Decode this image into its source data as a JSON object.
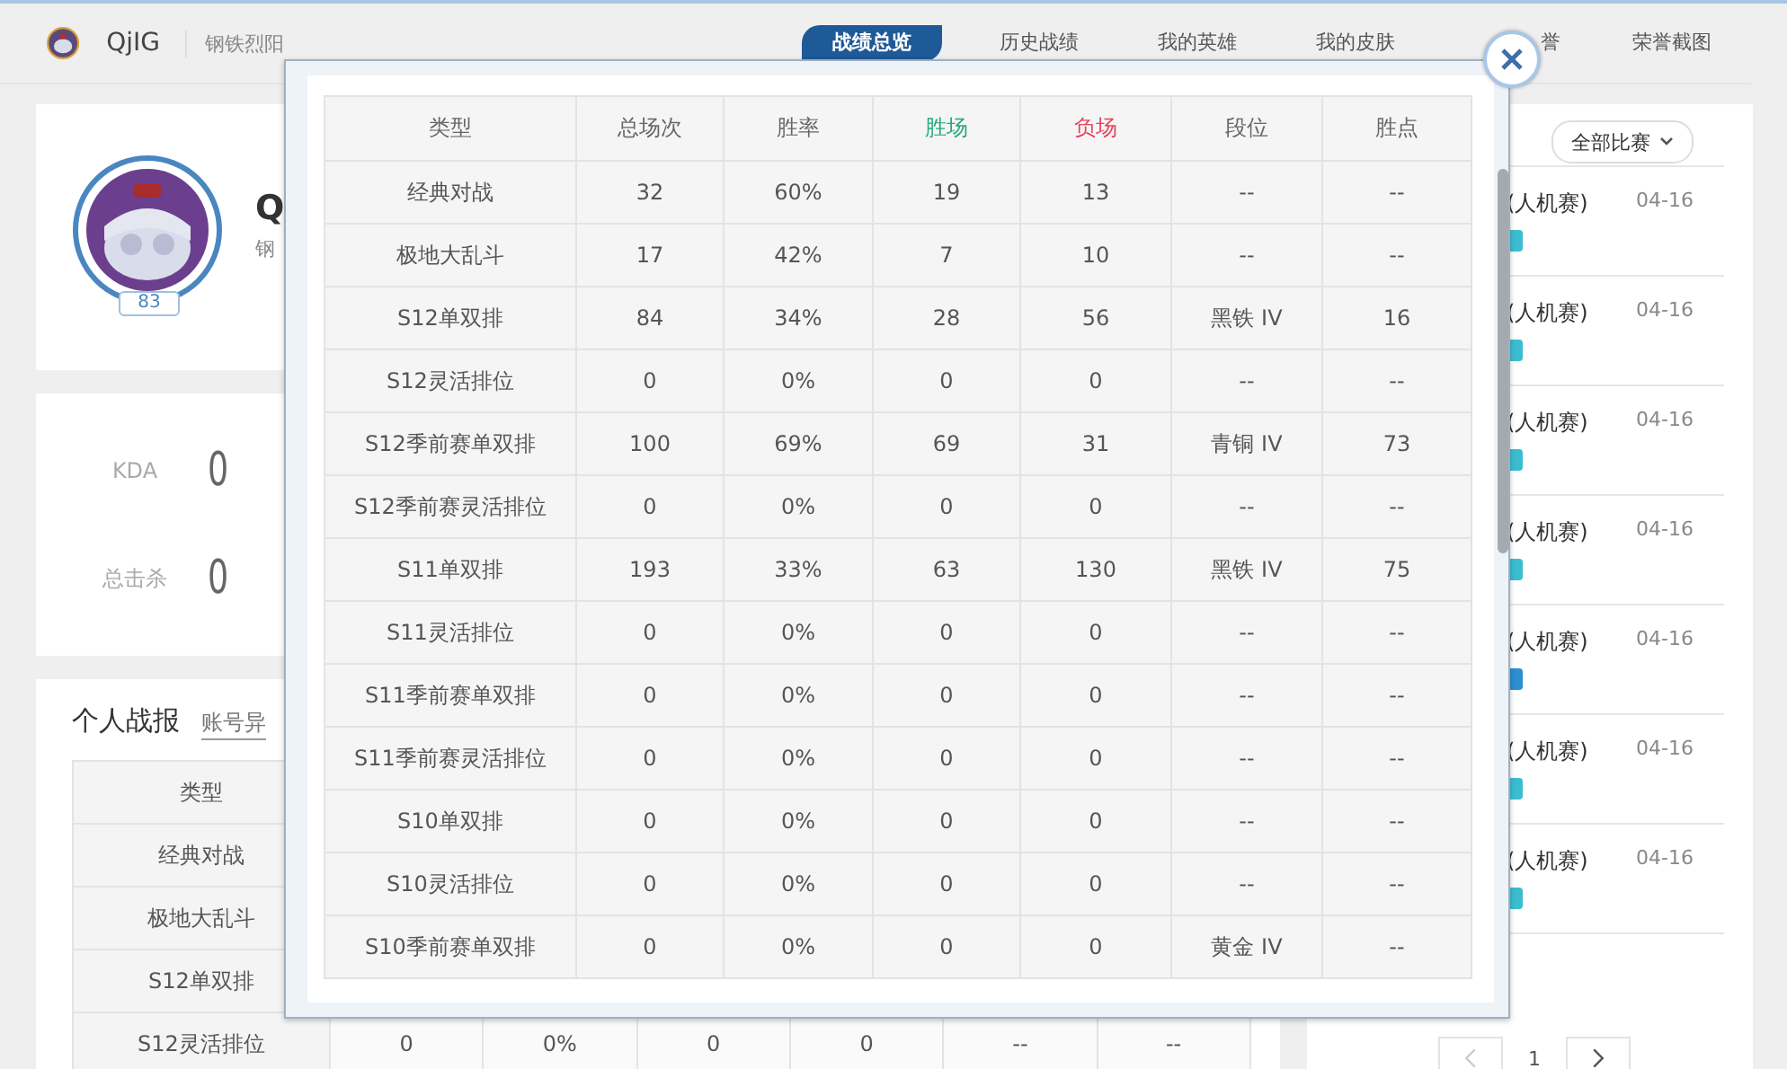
{
  "header": {
    "user_name": "QjIG",
    "server": "钢铁烈阳"
  },
  "nav_tabs": [
    {
      "label": "战绩总览",
      "selected": true,
      "partial": false
    },
    {
      "label": "历史战绩",
      "selected": false,
      "partial": false
    },
    {
      "label": "我的英雄",
      "selected": false,
      "partial": false
    },
    {
      "label": "我的皮肤",
      "selected": false,
      "partial": false
    },
    {
      "label": "誉",
      "selected": false,
      "partial": true
    },
    {
      "label": "荣誉截图",
      "selected": false,
      "partial": false
    }
  ],
  "profile": {
    "name": "Q",
    "server": "钢",
    "level": "83"
  },
  "stats": [
    {
      "label": "KDA",
      "value": "0"
    },
    {
      "label": "总击杀",
      "value": "0"
    }
  ],
  "report": {
    "title": "个人战报",
    "link": "账号异",
    "header": "类型",
    "rows": [
      {
        "type": "经典对战"
      },
      {
        "type": "极地大乱斗"
      },
      {
        "type": "S12单双排"
      },
      {
        "type": "S12灵活排位",
        "cells": [
          "0",
          "0%",
          "0",
          "0",
          "--",
          "--"
        ]
      }
    ]
  },
  "matches": {
    "filter": "全部比赛",
    "items": [
      {
        "mode": "(人机赛)",
        "date": "04-16",
        "color": "#3bbdd0"
      },
      {
        "mode": "(人机赛)",
        "date": "04-16",
        "color": "#3bbdd0"
      },
      {
        "mode": "(人机赛)",
        "date": "04-16",
        "color": "#3bbdd0"
      },
      {
        "mode": "(人机赛)",
        "date": "04-16",
        "color": "#3bbdd0"
      },
      {
        "mode": "(人机赛)",
        "date": "04-16",
        "color": "#2b8fd0"
      },
      {
        "mode": "(人机赛)",
        "date": "04-16",
        "color": "#3bbdd0"
      },
      {
        "mode": "(人机赛)",
        "date": "04-16",
        "color": "#3bbdd0"
      }
    ],
    "page": "1"
  },
  "modal": {
    "columns": [
      {
        "label": "类型"
      },
      {
        "label": "总场次"
      },
      {
        "label": "胜率"
      },
      {
        "label": "胜场",
        "color": "#27a67c"
      },
      {
        "label": "负场",
        "color": "#e2455c"
      },
      {
        "label": "段位"
      },
      {
        "label": "胜点"
      }
    ],
    "rows": [
      [
        "经典对战",
        "32",
        "60%",
        "19",
        "13",
        "--",
        "--"
      ],
      [
        "极地大乱斗",
        "17",
        "42%",
        "7",
        "10",
        "--",
        "--"
      ],
      [
        "S12单双排",
        "84",
        "34%",
        "28",
        "56",
        "黑铁 IV",
        "16"
      ],
      [
        "S12灵活排位",
        "0",
        "0%",
        "0",
        "0",
        "--",
        "--"
      ],
      [
        "S12季前赛单双排",
        "100",
        "69%",
        "69",
        "31",
        "青铜 IV",
        "73"
      ],
      [
        "S12季前赛灵活排位",
        "0",
        "0%",
        "0",
        "0",
        "--",
        "--"
      ],
      [
        "S11单双排",
        "193",
        "33%",
        "63",
        "130",
        "黑铁 IV",
        "75"
      ],
      [
        "S11灵活排位",
        "0",
        "0%",
        "0",
        "0",
        "--",
        "--"
      ],
      [
        "S11季前赛单双排",
        "0",
        "0%",
        "0",
        "0",
        "--",
        "--"
      ],
      [
        "S11季前赛灵活排位",
        "0",
        "0%",
        "0",
        "0",
        "--",
        "--"
      ],
      [
        "S10单双排",
        "0",
        "0%",
        "0",
        "0",
        "--",
        "--"
      ],
      [
        "S10灵活排位",
        "0",
        "0%",
        "0",
        "0",
        "--",
        "--"
      ],
      [
        "S10季前赛单双排",
        "0",
        "0%",
        "0",
        "0",
        "黄金 IV",
        "--"
      ]
    ]
  }
}
